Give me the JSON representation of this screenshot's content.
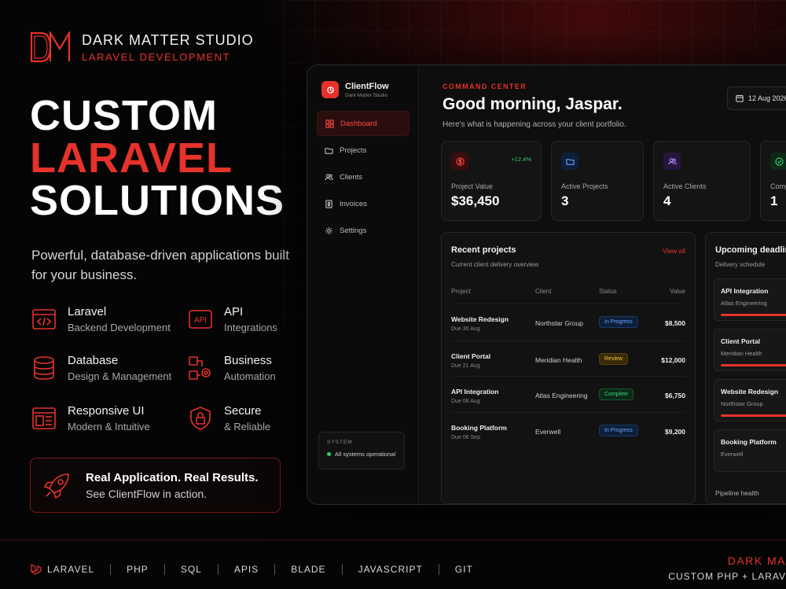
{
  "brand": {
    "name": "DARK MATTER STUDIO",
    "tagline": "LARAVEL DEVELOPMENT"
  },
  "hero": {
    "line1": "CUSTOM",
    "line2": "LARAVEL",
    "line3": "SOLUTIONS",
    "description": "Powerful, database-driven applications built for your business."
  },
  "features": [
    {
      "icon": "code-window-icon",
      "title": "Laravel",
      "subtitle": "Backend Development"
    },
    {
      "icon": "api-icon",
      "title": "API",
      "subtitle": "Integrations"
    },
    {
      "icon": "database-icon",
      "title": "Database",
      "subtitle": "Design & Management"
    },
    {
      "icon": "automation-icon",
      "title": "Business",
      "subtitle": "Automation"
    },
    {
      "icon": "layout-icon",
      "title": "Responsive UI",
      "subtitle": "Modern & Intuitive"
    },
    {
      "icon": "shield-lock-icon",
      "title": "Secure",
      "subtitle": "& Reliable"
    }
  ],
  "cta": {
    "title": "Real Application. Real Results.",
    "subtitle": "See ClientFlow in action."
  },
  "app": {
    "name": "ClientFlow",
    "studio": "Dark Matter Studio",
    "nav": [
      "Dashboard",
      "Projects",
      "Clients",
      "Invoices",
      "Settings"
    ],
    "system_label": "SYSTEM",
    "system_status": "All systems operational",
    "eyebrow": "COMMAND CENTER",
    "greeting": "Good morning, Jaspar.",
    "greeting_sub": "Here's what is happening across your client portfolio.",
    "date": "12 Aug 2026",
    "stats": [
      {
        "label": "Project Value",
        "value": "$36,450",
        "delta": "+12.4%"
      },
      {
        "label": "Active Projects",
        "value": "3"
      },
      {
        "label": "Active Clients",
        "value": "4"
      },
      {
        "label": "Comp",
        "value": "1"
      }
    ],
    "recent": {
      "title": "Recent projects",
      "subtitle": "Current client delivery overview",
      "view_all": "View all",
      "columns": [
        "Project",
        "Client",
        "Status",
        "Value"
      ],
      "rows": [
        {
          "project": "Website Redesign",
          "due": "Due 30 Aug",
          "client": "Northstar Group",
          "status": "In Progress",
          "value": "$8,500"
        },
        {
          "project": "Client Portal",
          "due": "Due 21 Aug",
          "client": "Meridian Health",
          "status": "Review",
          "value": "$12,000"
        },
        {
          "project": "API Integration",
          "due": "Due 08 Aug",
          "client": "Atlas Engineering",
          "status": "Complete",
          "value": "$6,750"
        },
        {
          "project": "Booking Platform",
          "due": "Due 06 Sep",
          "client": "Everwell",
          "status": "In Progress",
          "value": "$9,200"
        }
      ]
    },
    "deadlines": {
      "title": "Upcoming deadlin",
      "subtitle": "Delivery schedule",
      "items": [
        {
          "name": "API Integration",
          "client": "Atlas Engineering"
        },
        {
          "name": "Client Portal",
          "client": "Meridian Health"
        },
        {
          "name": "Website Redesign",
          "client": "Northstar Group"
        },
        {
          "name": "Booking Platform",
          "client": "Everwell"
        }
      ],
      "pipeline": "Pipeline health"
    }
  },
  "footer": {
    "tech": [
      "LARAVEL",
      "PHP",
      "SQL",
      "APIS",
      "BLADE",
      "JAVASCRIPT",
      "GIT"
    ],
    "brand_name": "DARK MA",
    "brand_tagline": "CUSTOM PHP + LARAV"
  },
  "colors": {
    "accent": "#e5322b",
    "background": "#050505",
    "success": "#2ecc71"
  }
}
